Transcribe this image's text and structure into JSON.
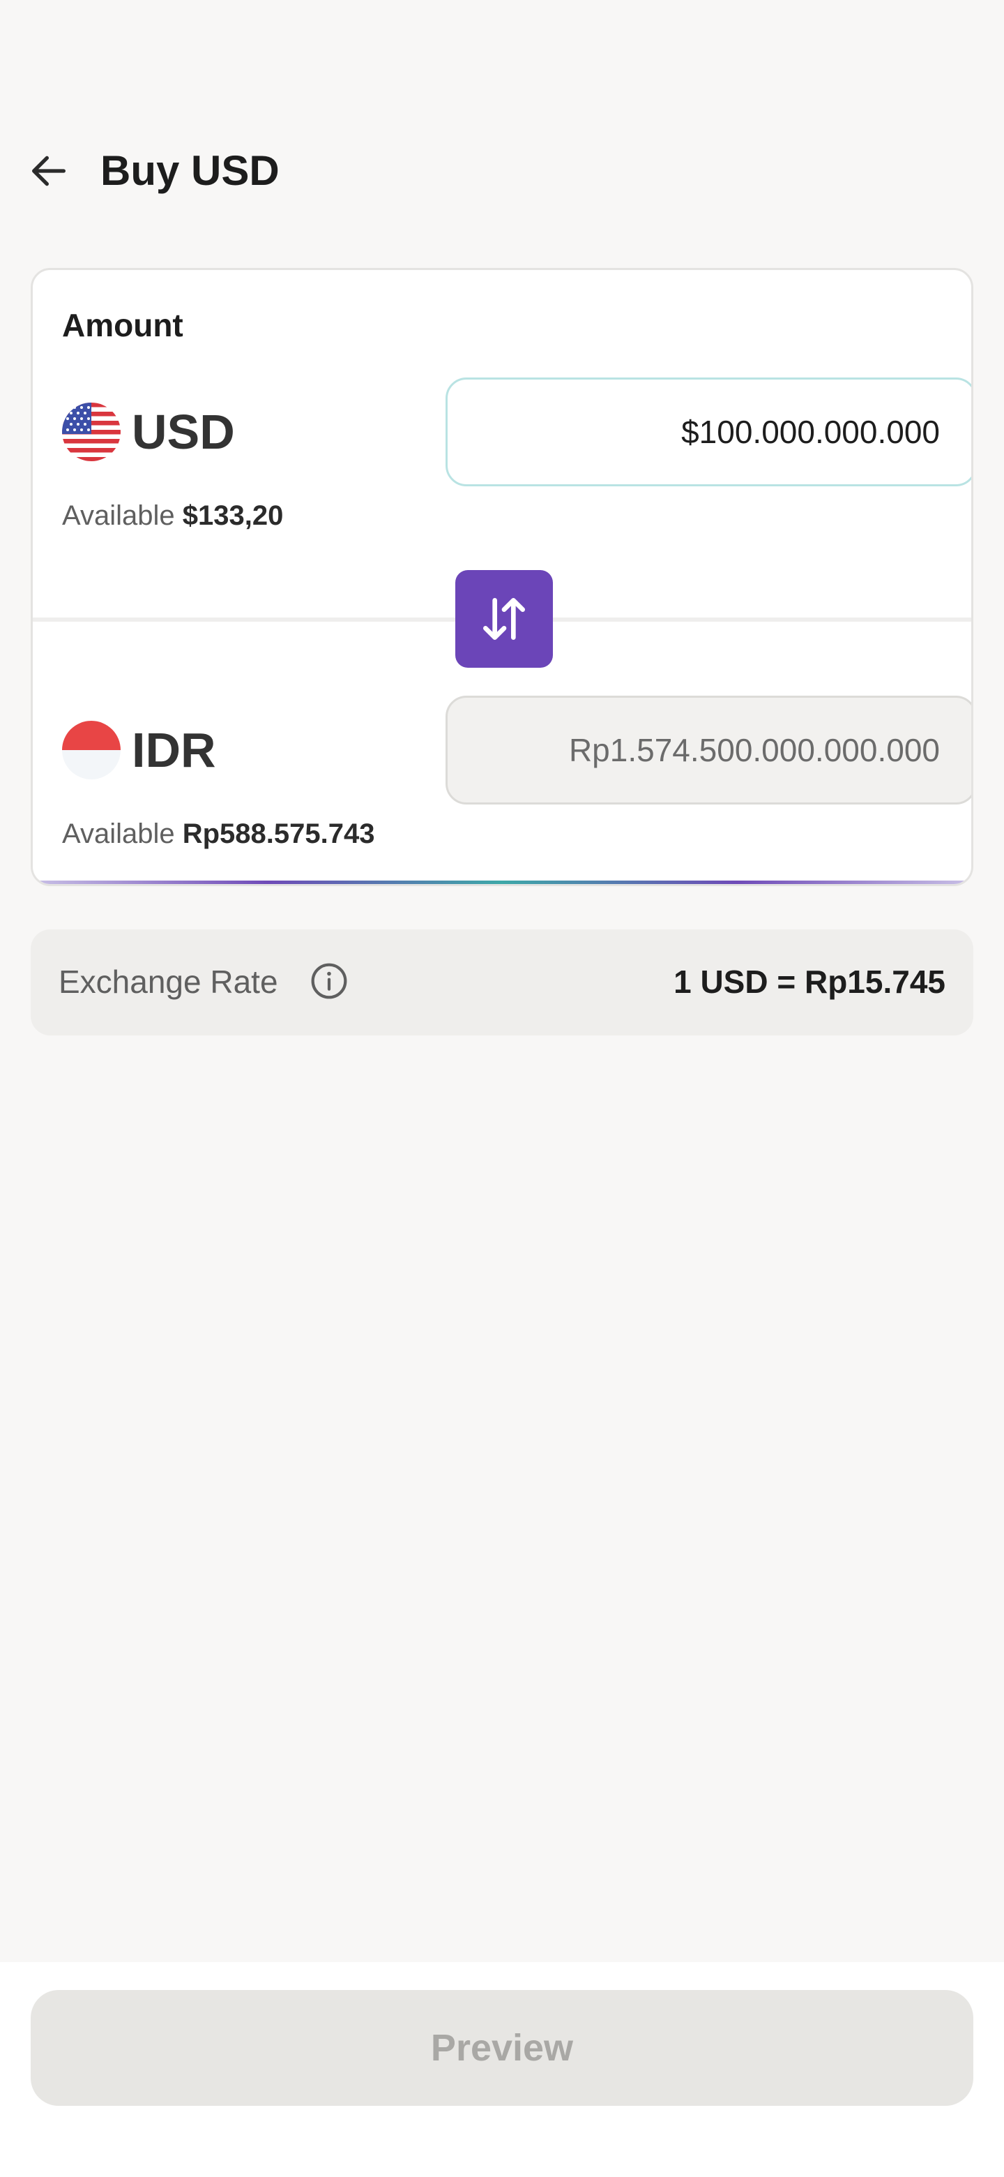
{
  "header": {
    "back_icon": "arrow-left-icon",
    "title": "Buy USD"
  },
  "amount_card": {
    "label": "Amount",
    "from": {
      "flag_icon": "us-flag-icon",
      "code": "USD",
      "value": "$100.000.000.000",
      "available_label": "Available",
      "available_value": "$133,20"
    },
    "swap_icon": "swap-vertical-icon",
    "to": {
      "flag_icon": "id-flag-icon",
      "code": "IDR",
      "value": "Rp1.574.500.000.000.000",
      "available_label": "Available",
      "available_value": "Rp588.575.743"
    }
  },
  "exchange": {
    "label": "Exchange Rate",
    "info_icon": "info-icon",
    "value": "1 USD = Rp15.745"
  },
  "footer": {
    "preview_label": "Preview"
  },
  "colors": {
    "accent": "#6b45b8",
    "input_border_active": "#b9e3e3",
    "background": "#f8f7f6"
  }
}
